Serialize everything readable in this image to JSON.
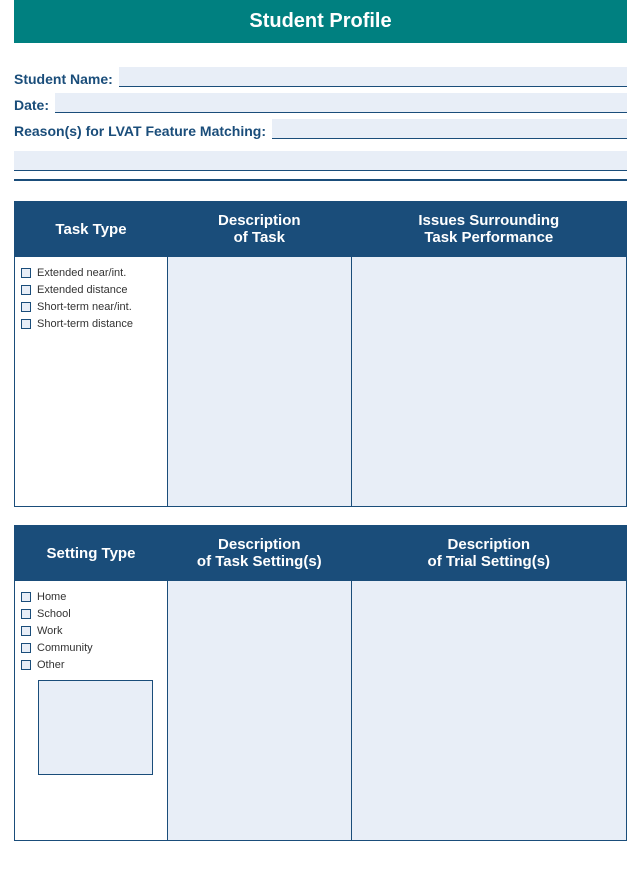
{
  "title": "Student Profile",
  "fields": {
    "student_name_label": "Student Name:",
    "student_name_value": "",
    "date_label": "Date:",
    "date_value": "",
    "reasons_label": "Reason(s) for LVAT Feature Matching:",
    "reasons_value": "",
    "reasons_line2": ""
  },
  "table1": {
    "headers": {
      "col1": "Task Type",
      "col2_line1": "Description",
      "col2_line2": "of Task",
      "col3_line1": "Issues Surrounding",
      "col3_line2": "Task Performance"
    },
    "checkboxes": [
      "Extended near/int.",
      "Extended distance",
      "Short-term near/int.",
      "Short-term distance"
    ]
  },
  "table2": {
    "headers": {
      "col1": "Setting Type",
      "col2_line1": "Description",
      "col2_line2": "of Task Setting(s)",
      "col3_line1": "Description",
      "col3_line2": "of Trial Setting(s)"
    },
    "checkboxes": [
      "Home",
      "School",
      "Work",
      "Community",
      "Other"
    ],
    "other_value": ""
  }
}
